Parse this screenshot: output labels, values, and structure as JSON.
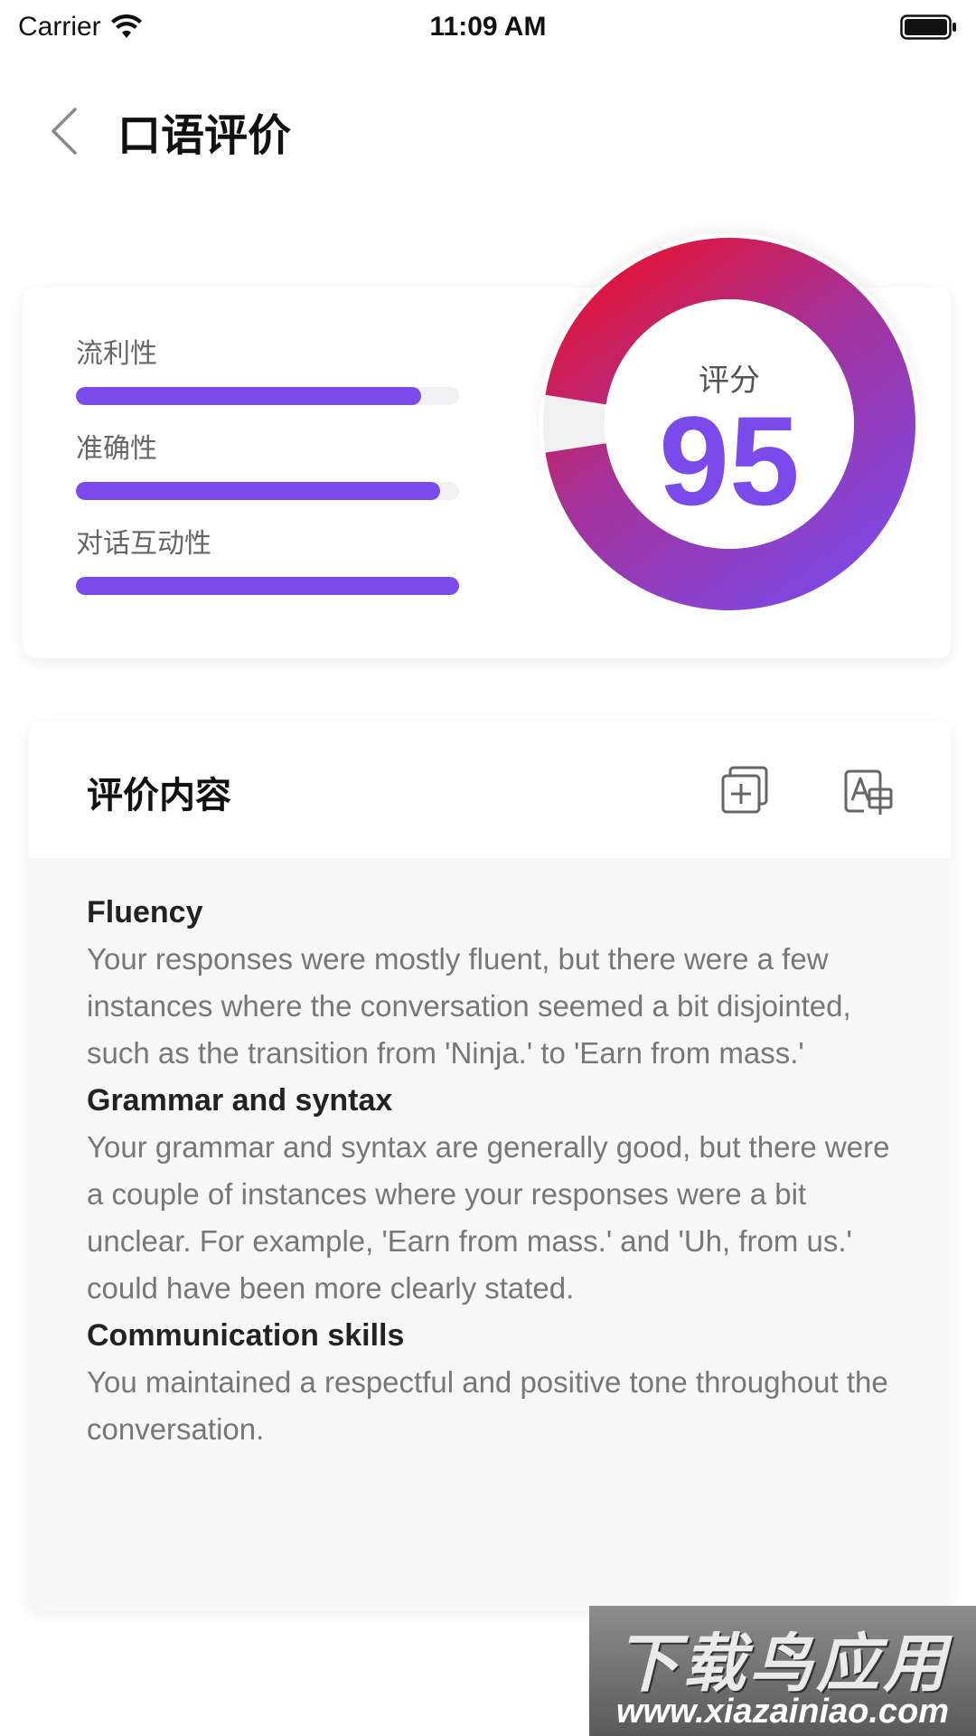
{
  "status_bar": {
    "carrier": "Carrier",
    "time": "11:09 AM"
  },
  "nav": {
    "title": "口语评价"
  },
  "score_card": {
    "metrics": [
      {
        "label": "流利性",
        "value": 0.9
      },
      {
        "label": "准确性",
        "value": 0.95
      },
      {
        "label": "对话互动性",
        "value": 1.0
      }
    ],
    "score_label": "评分",
    "score": "95",
    "colors": {
      "accent": "#7a4bea",
      "ring_start": "#7a4bea",
      "ring_end": "#e8112d"
    }
  },
  "evaluation": {
    "title": "评价内容",
    "icons": [
      "copy-add-icon",
      "translate-icon"
    ],
    "sections": [
      {
        "heading": "Fluency",
        "text": "Your responses were mostly fluent, but there were a few instances where the conversation seemed a bit disjointed, such as the transition from 'Ninja.' to 'Earn from mass.'"
      },
      {
        "heading": "Grammar and syntax",
        "text": "Your grammar and syntax are generally good, but there were a couple of instances where your responses were a bit unclear. For example, 'Earn from mass.' and 'Uh, from us.' could have been more clearly stated."
      },
      {
        "heading": "Communication skills",
        "text": "You maintained a respectful and positive tone throughout the conversation."
      }
    ]
  },
  "watermark": {
    "text": "下载鸟应用",
    "url": "www.xiazainiao.com"
  }
}
